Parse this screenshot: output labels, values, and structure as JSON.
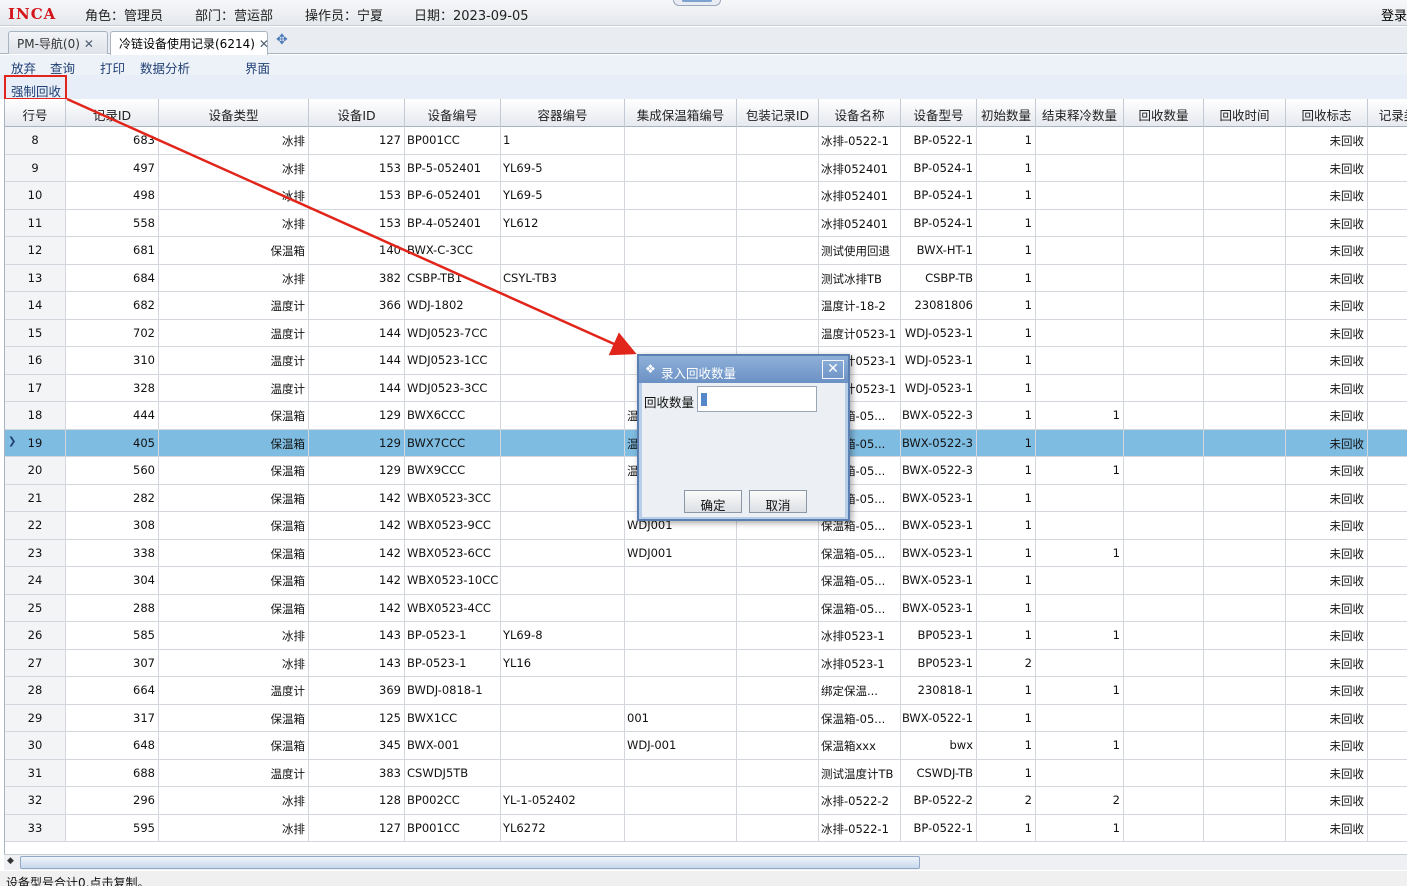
{
  "header": {
    "logo": "INCA",
    "role": "角色：管理员",
    "dept": "部门：营运部",
    "operator": "操作员：宁夏",
    "date": "日期：2023-09-05",
    "login": "登录"
  },
  "tabs": [
    {
      "label": "PM-导航(0)"
    },
    {
      "label": "冷链设备使用记录(6214)"
    }
  ],
  "menu": [
    "放弃",
    "查询",
    "打印",
    "数据分析",
    "界面"
  ],
  "toolbar": {
    "force_recall": "强制回收"
  },
  "columns": [
    "行号",
    "记录ID",
    "设备类型",
    "设备ID",
    "设备编号",
    "容器编号",
    "集成保温箱编号",
    "包装记录ID",
    "设备名称",
    "设备型号",
    "初始数量",
    "结束释冷数量",
    "回收数量",
    "回收时间",
    "回收标志",
    "记录类"
  ],
  "rows": [
    [
      "8",
      "683",
      "冰排",
      "127",
      "BP001CC",
      "1",
      "",
      "",
      "冰排-0522-1",
      "BP-0522-1",
      "1",
      "",
      "",
      "",
      "未回收",
      ""
    ],
    [
      "9",
      "497",
      "冰排",
      "153",
      "BP-5-052401",
      "YL69-5",
      "",
      "",
      "冰排052401",
      "BP-0524-1",
      "1",
      "",
      "",
      "",
      "未回收",
      ""
    ],
    [
      "10",
      "498",
      "冰排",
      "153",
      "BP-6-052401",
      "YL69-5",
      "",
      "",
      "冰排052401",
      "BP-0524-1",
      "1",
      "",
      "",
      "",
      "未回收",
      ""
    ],
    [
      "11",
      "558",
      "冰排",
      "153",
      "BP-4-052401",
      "YL612",
      "",
      "",
      "冰排052401",
      "BP-0524-1",
      "1",
      "",
      "",
      "",
      "未回收",
      ""
    ],
    [
      "12",
      "681",
      "保温箱",
      "140",
      "BWX-C-3CC",
      "",
      "",
      "",
      "测试使用回退",
      "BWX-HT-1",
      "1",
      "",
      "",
      "",
      "未回收",
      ""
    ],
    [
      "13",
      "684",
      "冰排",
      "382",
      "CSBP-TB1",
      "CSYL-TB3",
      "",
      "",
      "测试冰排TB",
      "CSBP-TB",
      "1",
      "",
      "",
      "",
      "未回收",
      ""
    ],
    [
      "14",
      "682",
      "温度计",
      "366",
      "WDJ-1802",
      "",
      "",
      "",
      "温度计-18-2",
      "23081806",
      "1",
      "",
      "",
      "",
      "未回收",
      ""
    ],
    [
      "15",
      "702",
      "温度计",
      "144",
      "WDJ0523-7CC",
      "",
      "",
      "",
      "温度计0523-1",
      "WDJ-0523-1",
      "1",
      "",
      "",
      "",
      "未回收",
      ""
    ],
    [
      "16",
      "310",
      "温度计",
      "144",
      "WDJ0523-1CC",
      "",
      "",
      "",
      "温度计0523-1",
      "WDJ-0523-1",
      "1",
      "",
      "",
      "",
      "未回收",
      ""
    ],
    [
      "17",
      "328",
      "温度计",
      "144",
      "WDJ0523-3CC",
      "",
      "",
      "",
      "温度计0523-1",
      "WDJ-0523-1",
      "1",
      "",
      "",
      "",
      "未回收",
      ""
    ],
    [
      "18",
      "444",
      "保温箱",
      "129",
      "BWX6CCC",
      "",
      "温",
      "",
      "保温箱-05...",
      "BWX-0522-3",
      "1",
      "1",
      "",
      "",
      "未回收",
      ""
    ],
    [
      "19",
      "405",
      "保温箱",
      "129",
      "BWX7CCC",
      "",
      "温",
      "",
      "保温箱-05...",
      "BWX-0522-3",
      "1",
      "",
      "",
      "",
      "未回收",
      ""
    ],
    [
      "20",
      "560",
      "保温箱",
      "129",
      "BWX9CCC",
      "",
      "温",
      "",
      "保温箱-05...",
      "BWX-0522-3",
      "1",
      "1",
      "",
      "",
      "未回收",
      ""
    ],
    [
      "21",
      "282",
      "保温箱",
      "142",
      "WBX0523-3CC",
      "",
      "",
      "",
      "保温箱-05...",
      "BWX-0523-1",
      "1",
      "",
      "",
      "",
      "未回收",
      ""
    ],
    [
      "22",
      "308",
      "保温箱",
      "142",
      "WBX0523-9CC",
      "",
      "WDJ001",
      "",
      "保温箱-05...",
      "BWX-0523-1",
      "1",
      "",
      "",
      "",
      "未回收",
      ""
    ],
    [
      "23",
      "338",
      "保温箱",
      "142",
      "WBX0523-6CC",
      "",
      "WDJ001",
      "",
      "保温箱-05...",
      "BWX-0523-1",
      "1",
      "1",
      "",
      "",
      "未回收",
      ""
    ],
    [
      "24",
      "304",
      "保温箱",
      "142",
      "WBX0523-10CC",
      "",
      "",
      "",
      "保温箱-05...",
      "BWX-0523-1",
      "1",
      "",
      "",
      "",
      "未回收",
      ""
    ],
    [
      "25",
      "288",
      "保温箱",
      "142",
      "WBX0523-4CC",
      "",
      "",
      "",
      "保温箱-05...",
      "BWX-0523-1",
      "1",
      "",
      "",
      "",
      "未回收",
      ""
    ],
    [
      "26",
      "585",
      "冰排",
      "143",
      "BP-0523-1",
      "YL69-8",
      "",
      "",
      "冰排0523-1",
      "BP0523-1",
      "1",
      "1",
      "",
      "",
      "未回收",
      ""
    ],
    [
      "27",
      "307",
      "冰排",
      "143",
      "BP-0523-1",
      "YL16",
      "",
      "",
      "冰排0523-1",
      "BP0523-1",
      "2",
      "",
      "",
      "",
      "未回收",
      ""
    ],
    [
      "28",
      "664",
      "温度计",
      "369",
      "BWDJ-0818-1",
      "",
      "",
      "",
      "绑定保温...",
      "230818-1",
      "1",
      "1",
      "",
      "",
      "未回收",
      ""
    ],
    [
      "29",
      "317",
      "保温箱",
      "125",
      "BWX1CC",
      "",
      "001",
      "",
      "保温箱-05...",
      "BWX-0522-1",
      "1",
      "",
      "",
      "",
      "未回收",
      ""
    ],
    [
      "30",
      "648",
      "保温箱",
      "345",
      "BWX-001",
      "",
      "WDJ-001",
      "",
      "保温箱xxx",
      "bwx",
      "1",
      "1",
      "",
      "",
      "未回收",
      ""
    ],
    [
      "31",
      "688",
      "温度计",
      "383",
      "CSWDJ5TB",
      "",
      "",
      "",
      "测试温度计TB",
      "CSWDJ-TB",
      "1",
      "",
      "",
      "",
      "未回收",
      ""
    ],
    [
      "32",
      "296",
      "冰排",
      "128",
      "BP002CC",
      "YL-1-052402",
      "",
      "",
      "冰排-0522-2",
      "BP-0522-2",
      "2",
      "2",
      "",
      "",
      "未回收",
      ""
    ],
    [
      "33",
      "595",
      "冰排",
      "127",
      "BP001CC",
      "YL6272",
      "",
      "",
      "冰排-0522-1",
      "BP-0522-1",
      "1",
      "1",
      "",
      "",
      "未回收",
      ""
    ]
  ],
  "selected_row": "19",
  "dialog": {
    "title": "录入回收数量",
    "field_label": "回收数量",
    "field_value": "",
    "ok": "确定",
    "cancel": "取消"
  },
  "status": "设备型号合计0,点击复制。",
  "colors": {
    "annotation": "#e1251b",
    "selected_row": "#7fbce1",
    "dialog_title": "#6b91c4"
  }
}
